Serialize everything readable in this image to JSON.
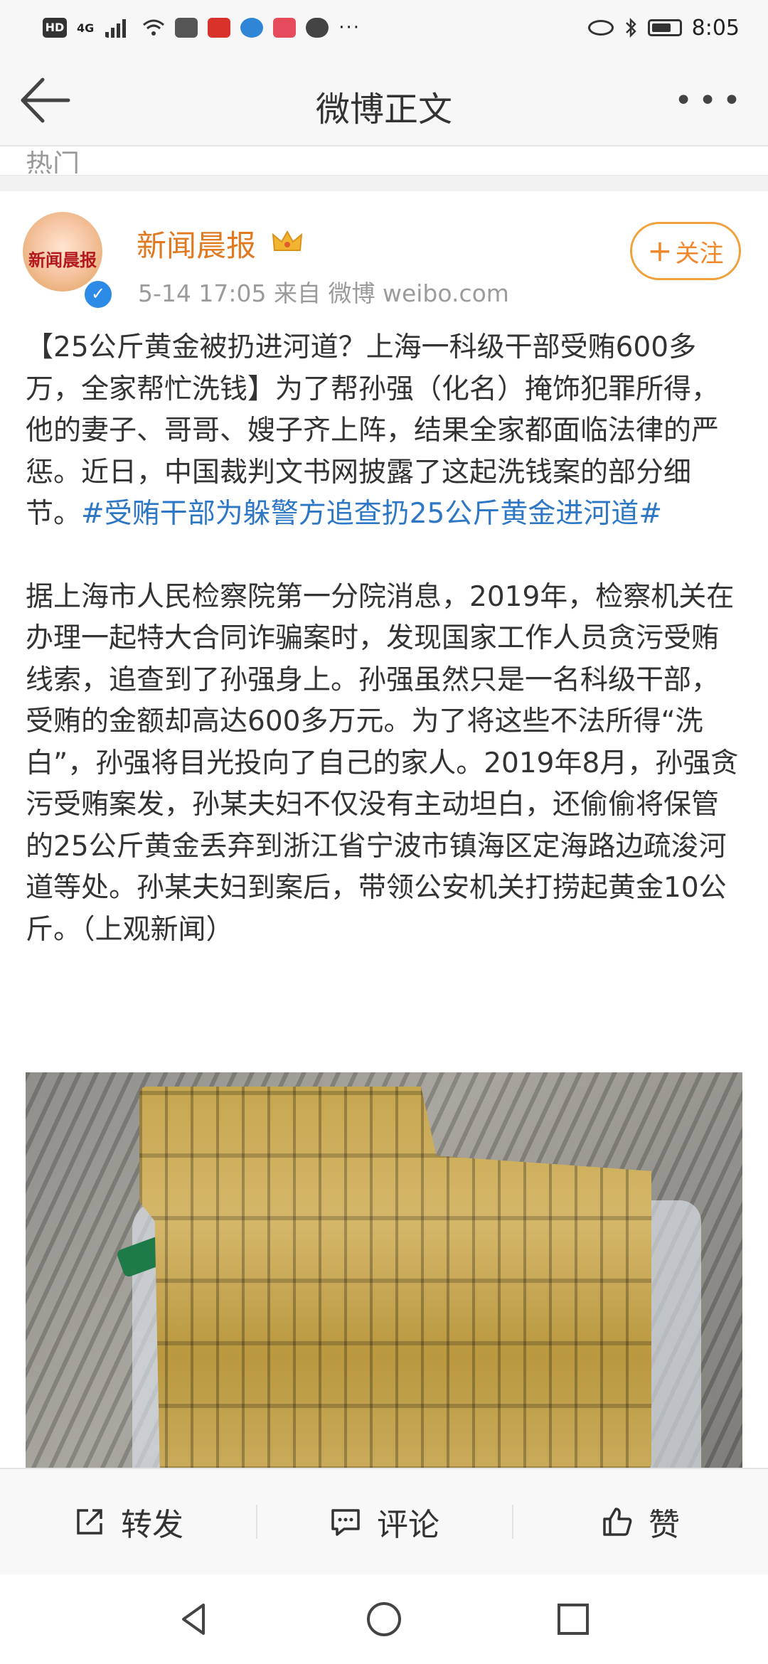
{
  "status_bar": {
    "hd_label": "HD",
    "network_label": "4G",
    "more_label": "···",
    "time": "8:05"
  },
  "nav": {
    "title": "微博正文"
  },
  "prev_stub_text": "热门",
  "post": {
    "author_name": "新闻晨报",
    "avatar_text": "新闻晨报",
    "verified_mark": "✓",
    "meta": "5-14 17:05  来自 微博 weibo.com",
    "follow_label": "关注",
    "follow_plus": "+",
    "paragraph1_text": "【25公斤黄金被扔进河道？上海一科级干部受贿600多万，全家帮忙洗钱】为了帮孙强（化名）掩饰犯罪所得，他的妻子、哥哥、嫂子齐上阵，结果全家都面临法律的严惩。近日，中国裁判文书网披露了这起洗钱案的部分细节。",
    "paragraph1_topic": "#受贿干部为躲警方追查扔25公斤黄金进河道#",
    "paragraph2": "据上海市人民检察院第一分院消息，2019年，检察机关在办理一起特大合同诈骗案时，发现国家工作人员贪污受贿线索，追查到了孙强身上。孙强虽然只是一名科级干部，受贿的金额却高达600多万元。为了将这些不法所得“洗白”，孙强将目光投向了自己的家人。2019年8月，孙强贪污受贿案发，孙某夫妇不仅没有主动坦白，还偷偷将保管的25公斤黄金丢弃到浙江省宁波市镇海区定海路边疏浚河道等处。孙某夫妇到案后，带领公安机关打捞起黄金10公斤。（上观新闻）"
  },
  "actions": {
    "repost": "转发",
    "comment": "评论",
    "like": "赞"
  },
  "colors": {
    "author_name": "#e07a21",
    "topic_link": "#2e77c4",
    "follow_border": "#f1a13b",
    "verified": "#2b8be6"
  }
}
